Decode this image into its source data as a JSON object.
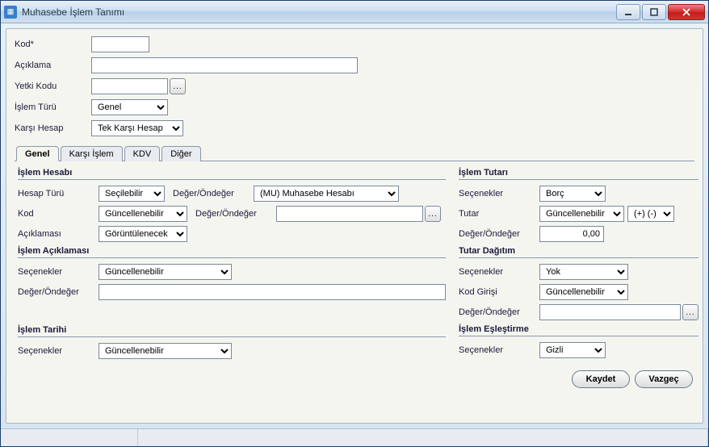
{
  "window": {
    "title": "Muhasebe İşlem Tanımı"
  },
  "header": {
    "kod_label": "Kod*",
    "aciklama_label": "Açıklama",
    "yetki_kodu_label": "Yetki Kodu",
    "islem_turu_label": "İşlem Türü",
    "karsi_hesap_label": "Karşı Hesap",
    "islem_turu_value": "Genel",
    "karsi_hesap_value": "Tek Karşı Hesap"
  },
  "tabs": {
    "genel": "Genel",
    "karsi_islem": "Karşı İşlem",
    "kdv": "KDV",
    "diger": "Diğer"
  },
  "islem_hesabi": {
    "title": "İşlem Hesabı",
    "hesap_turu_label": "Hesap Türü",
    "hesap_turu_value": "Seçilebilir",
    "kod_label": "Kod",
    "kod_value": "Güncellenebilir",
    "aciklamasi_label": "Açıklaması",
    "aciklamasi_value": "Görüntülenecek",
    "deger_ondeger_label": "Değer/Öndeğer",
    "deger_ondeger1_value": "(MU) Muhasebe Hesabı"
  },
  "islem_aciklamasi": {
    "title": "İşlem Açıklaması",
    "secenekler_label": "Seçenekler",
    "secenekler_value": "Güncellenebilir",
    "deger_ondeger_label": "Değer/Öndeğer"
  },
  "islem_tarihi": {
    "title": "İşlem Tarihi",
    "secenekler_label": "Seçenekler",
    "secenekler_value": "Güncellenebilir"
  },
  "islem_tutari": {
    "title": "İşlem Tutarı",
    "secenekler_label": "Seçenekler",
    "secenekler_value": "Borç",
    "tutar_label": "Tutar",
    "tutar_value": "Güncellenebilir",
    "tutar_sign_value": "(+) (-)",
    "deger_ondeger_label": "Değer/Öndeğer",
    "deger_ondeger_value": "0,00"
  },
  "tutar_dagitim": {
    "title": "Tutar Dağıtım",
    "secenekler_label": "Seçenekler",
    "secenekler_value": "Yok",
    "kod_girisi_label": "Kod Girişi",
    "kod_girisi_value": "Güncellenebilir",
    "deger_ondeger_label": "Değer/Öndeğer"
  },
  "islem_eslestirme": {
    "title": "İşlem Eşleştirme",
    "secenekler_label": "Seçenekler",
    "secenekler_value": "Gizli"
  },
  "footer": {
    "kaydet": "Kaydet",
    "vazgec": "Vazgeç"
  }
}
